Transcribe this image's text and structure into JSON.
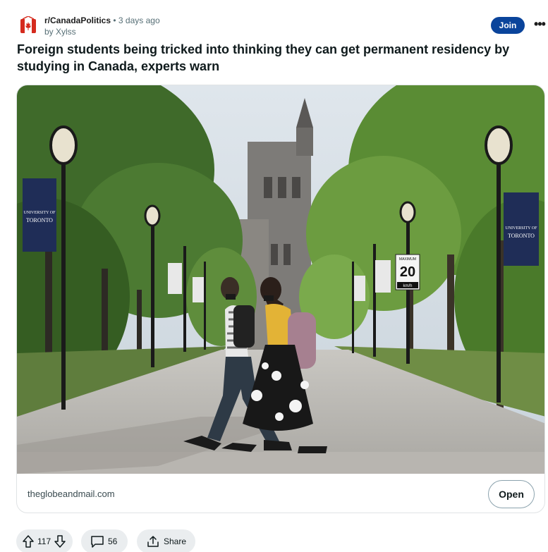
{
  "post": {
    "subreddit": "r/CanadaPolitics",
    "separator": "•",
    "time": "3 days ago",
    "author_line": "by Xylss",
    "join_label": "Join",
    "more_label": "•••",
    "title": "Foreign students being tricked into thinking they can get permanent residency by studying in Canada, experts warn"
  },
  "link_card": {
    "domain": "theglobeandmail.com",
    "open_label": "Open",
    "image": {
      "banner_text_line1": "UNIVERSITY OF",
      "banner_text_line2": "TORONTO",
      "sign_top": "MAXIMUM",
      "sign_number": "20",
      "sign_unit": "km/h"
    }
  },
  "actions": {
    "votes": "117",
    "comments": "56",
    "share_label": "Share"
  },
  "colors": {
    "join_bg": "#0a449b",
    "pill_bg": "#eaedef",
    "subreddit_icon": "#d52b1e"
  }
}
